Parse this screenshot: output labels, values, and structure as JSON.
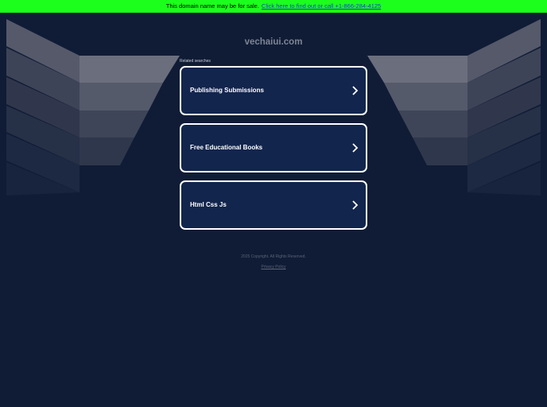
{
  "sale_bar": {
    "text": "This domain name may be for sale.",
    "link_text": "Click here to find out or call +1-866-284-4125",
    "background": "#1cff1c"
  },
  "domain": "vechaiui.com",
  "related_label": "Related searches",
  "searches": [
    {
      "label": "Publishing Submissions",
      "icon": "chevron-right-icon"
    },
    {
      "label": "Free Educational Books",
      "icon": "chevron-right-icon"
    },
    {
      "label": "Html Css Js",
      "icon": "chevron-right-icon"
    }
  ],
  "footer": {
    "copyright": "2025 Copyright. All Rights Reserved.",
    "privacy": "Privacy Policy"
  },
  "colors": {
    "background": "#101c36",
    "card": "#12254d",
    "card_border": "#ffffff"
  }
}
